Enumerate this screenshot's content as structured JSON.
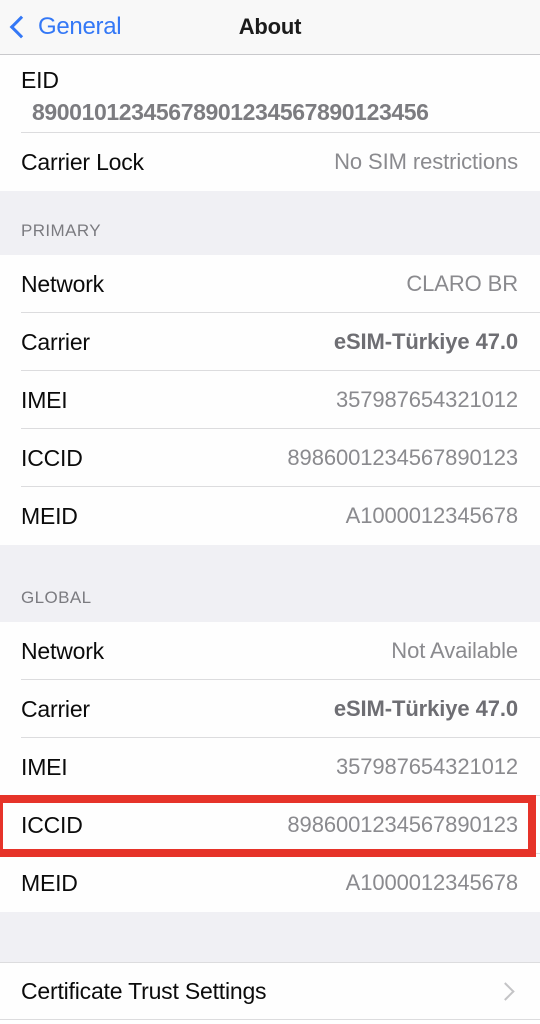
{
  "navbar": {
    "back_label": "General",
    "back_icon": "chevron-left-icon",
    "title": "About"
  },
  "colors": {
    "accent_blue": "#3478F6",
    "highlight_red": "#E63329",
    "group_background": "#FEFEFE",
    "section_gap_background": "#F0F0F4",
    "value_gray": "#8A8A8E",
    "separator": "#DCDCDE"
  },
  "top_group": {
    "eid_row": {
      "label": "EID",
      "value": "89001012345678901234567890123456"
    },
    "carrier_lock_row": {
      "label": "Carrier Lock",
      "value": "No SIM restrictions"
    }
  },
  "primary_section": {
    "header": "PRIMARY",
    "rows": [
      {
        "label": "Network",
        "value": "CLARO BR",
        "bold": false
      },
      {
        "label": "Carrier",
        "value": "eSIM-Türkiye 47.0",
        "bold": true
      },
      {
        "label": "IMEI",
        "value": "357987654321012",
        "bold": false
      },
      {
        "label": "ICCID",
        "value": "8986001234567890123",
        "bold": false
      },
      {
        "label": "MEID",
        "value": "A1000012345678",
        "bold": false
      }
    ]
  },
  "global_section": {
    "header": "GLOBAL",
    "rows": [
      {
        "label": "Network",
        "value": "Not Available",
        "bold": false
      },
      {
        "label": "Carrier",
        "value": "eSIM-Türkiye 47.0",
        "bold": true
      },
      {
        "label": "IMEI",
        "value": "357987654321012",
        "bold": false
      },
      {
        "label": "ICCID",
        "value": "8986001234567890123",
        "bold": false
      },
      {
        "label": "MEID",
        "value": "A1000012345678",
        "bold": false
      }
    ],
    "highlighted_row_label": "ICCID"
  },
  "footer_group": {
    "certificate_trust_settings": {
      "label": "Certificate Trust Settings",
      "chevron_icon": "chevron-right-icon"
    }
  }
}
